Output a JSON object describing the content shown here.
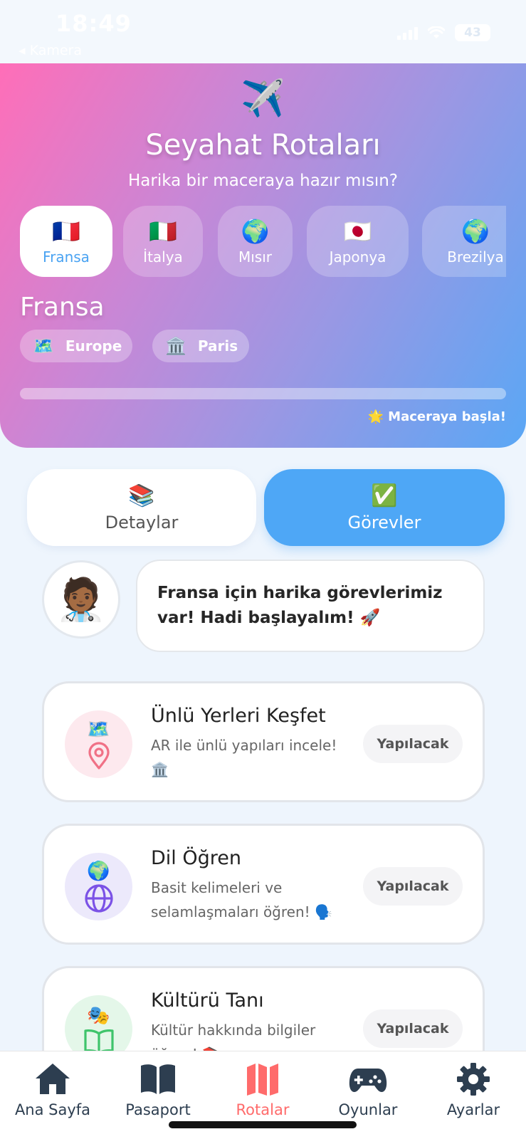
{
  "status_bar": {
    "time": "18:49",
    "back_label": "◂ Kamera",
    "battery": "43"
  },
  "hero": {
    "icon": "✈️",
    "title": "Seyahat Rotaları",
    "subtitle": "Harika bir maceraya hazır mısın?",
    "countries": [
      {
        "flag": "🇫🇷",
        "name": "Fransa",
        "active": true
      },
      {
        "flag": "🇮🇹",
        "name": "İtalya"
      },
      {
        "flag": "🌍",
        "name": "Mısır"
      },
      {
        "flag": "🇯🇵",
        "name": "Japonya"
      },
      {
        "flag": "🌍",
        "name": "Brezilya"
      }
    ],
    "selected_country": "Fransa",
    "tags": [
      {
        "icon": "🗺️",
        "label": "Europe"
      },
      {
        "icon": "🏛️",
        "label": "Paris"
      }
    ],
    "progress": 0,
    "start_label": "🌟 Maceraya başla!"
  },
  "tabs": [
    {
      "emoji": "📚",
      "label": "Detaylar"
    },
    {
      "emoji": "✅",
      "label": "Görevler",
      "active": true
    }
  ],
  "guide": {
    "avatar": "🧑🏾‍⚕️",
    "message": "Fransa için harika görevlerimiz var! Hadi başlayalım! 🚀"
  },
  "tasks": [
    {
      "emoji": "🗺️",
      "icon": "location-pin-icon",
      "title": "Ünlü Yerleri Keşfet",
      "description": "AR ile ünlü yapıları incele! 🏛️",
      "status": "Yapılacak",
      "color": "#f07186"
    },
    {
      "emoji": "🌍",
      "icon": "globe-icon",
      "title": "Dil Öğren",
      "description": "Basit kelimeleri ve selamlaşmaları öğren! 🗣️",
      "status": "Yapılacak",
      "color": "#7b52e6"
    },
    {
      "emoji": "🎭",
      "icon": "book-icon",
      "title": "Kültürü Tanı",
      "description": "Kültür hakkında bilgiler öğren! 📚",
      "status": "Yapılacak",
      "color": "#3fc46b"
    }
  ],
  "nav": [
    {
      "label": "Ana Sayfa",
      "icon": "home-icon"
    },
    {
      "label": "Pasaport",
      "icon": "passport-book-icon"
    },
    {
      "label": "Rotalar",
      "icon": "map-icon",
      "active": true
    },
    {
      "label": "Oyunlar",
      "icon": "gamepad-icon"
    },
    {
      "label": "Ayarlar",
      "icon": "gear-icon"
    }
  ],
  "colors": {
    "accent_blue": "#4ea7f6",
    "active_nav": "#ff6b6b",
    "nav_dark": "#2d3e50"
  }
}
